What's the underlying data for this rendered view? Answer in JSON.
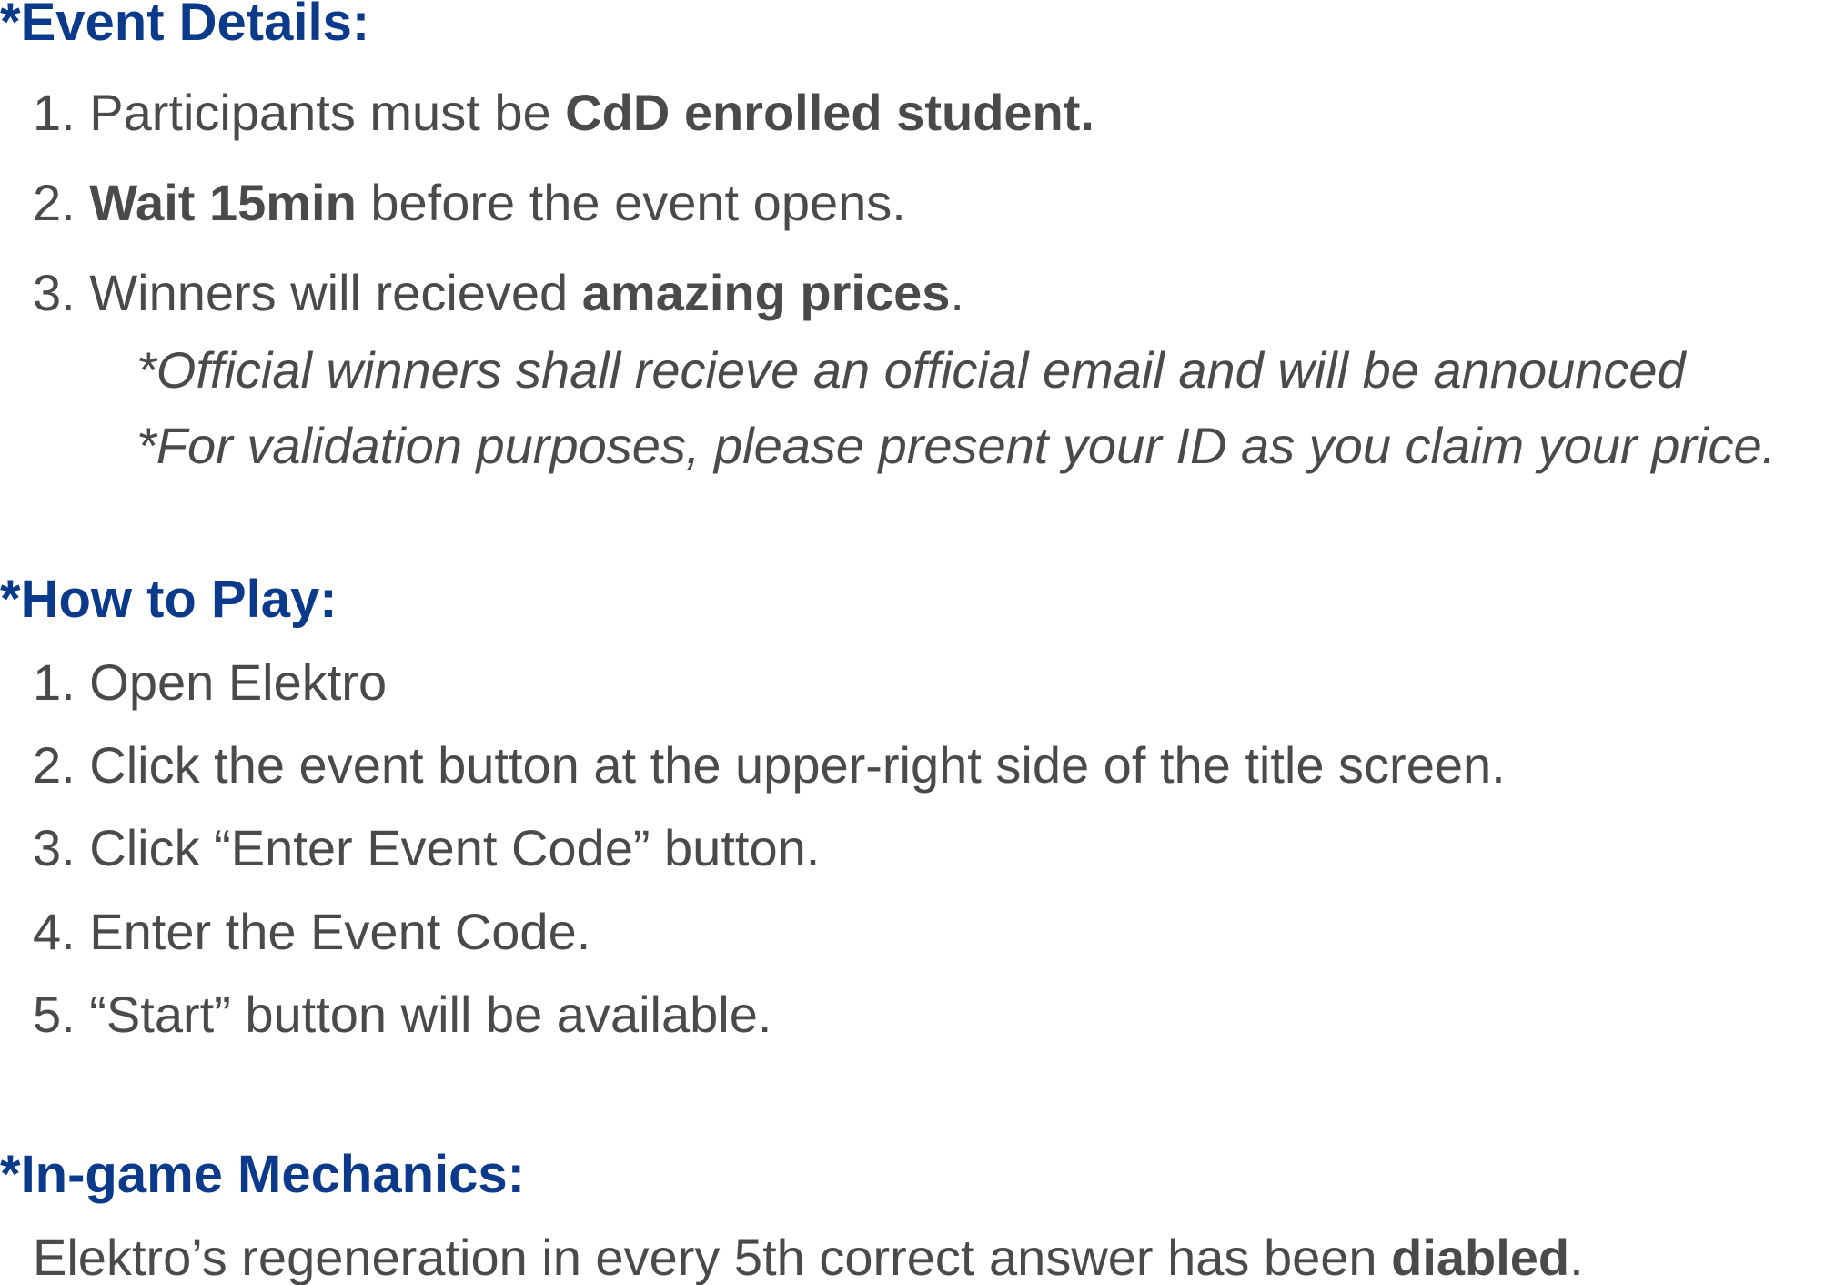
{
  "event_details": {
    "heading": "*Event Details:",
    "items": [
      {
        "num": "1. ",
        "pre": "Participants must be ",
        "bold": "CdD enrolled student.",
        "post": ""
      },
      {
        "num": "2. ",
        "pre": "",
        "bold": "Wait 15min",
        "post": " before the event opens."
      },
      {
        "num": "3. ",
        "pre": "Winners will recieved ",
        "bold": "amazing prices",
        "post": "."
      }
    ],
    "notes": [
      "*Official winners shall recieve an official email and will be announced",
      "*For validation purposes, please present your ID as you claim your price."
    ]
  },
  "how_to_play": {
    "heading": "*How to Play:",
    "steps": [
      "1. Open Elektro",
      "2. Click the event button at the upper-right side of the title screen.",
      "3. Click “Enter Event Code” button.",
      "4. Enter the Event Code.",
      "5. “Start” button will be available."
    ]
  },
  "mechanics": {
    "heading": "*In-game Mechanics:",
    "pre": "Elektro’s regeneration in every 5th correct answer has been ",
    "bold": "diabled",
    "post": "."
  },
  "colors": {
    "heading": "#0b3a8a",
    "body_text": "#4a4a4a",
    "background": "#ffffff"
  }
}
